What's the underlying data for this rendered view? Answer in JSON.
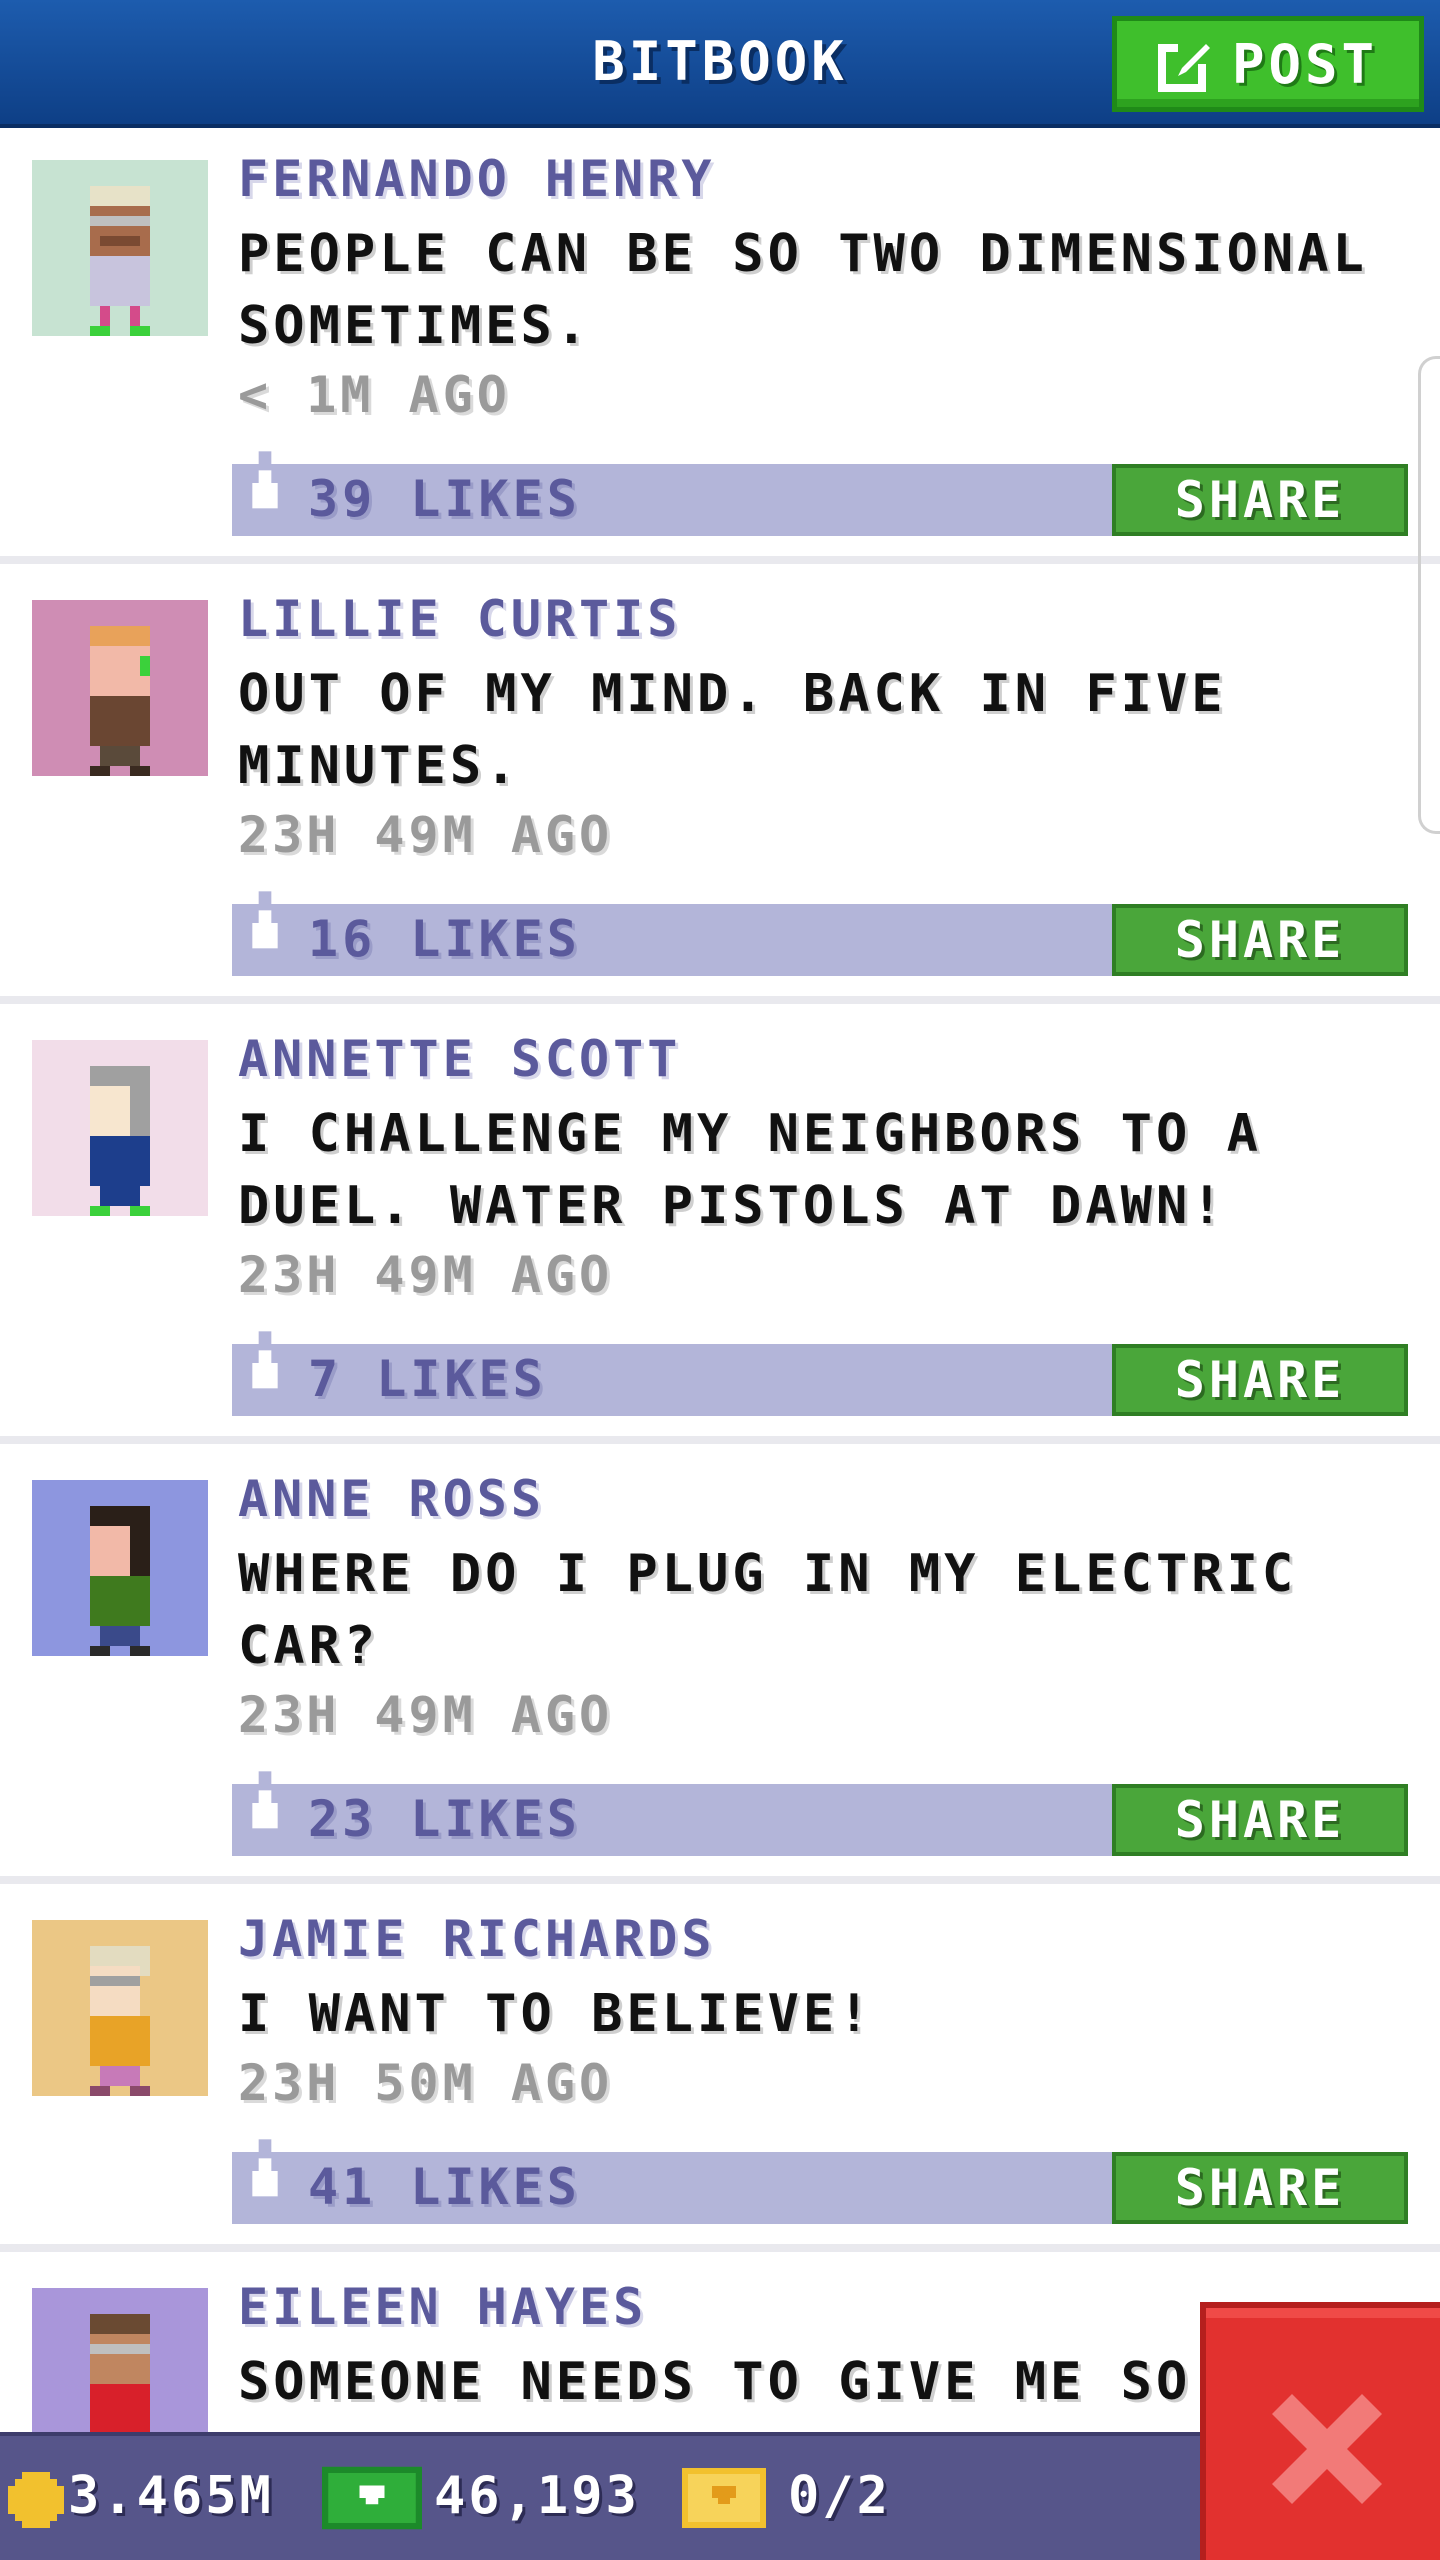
{
  "header": {
    "title": "BITBOOK",
    "post_label": "POST"
  },
  "posts": [
    {
      "name": "FERNANDO HENRY",
      "message": "PEOPLE CAN BE SO TWO DIMENSIONAL SOMETIMES.",
      "time": "< 1M AGO",
      "likes": "39 LIKES",
      "share": "SHARE",
      "avatar_bg": "#c7e3d2"
    },
    {
      "name": "LILLIE CURTIS",
      "message": "OUT OF MY MIND. BACK IN FIVE MINUTES.",
      "time": "23H 49M AGO",
      "likes": "16 LIKES",
      "share": "SHARE",
      "avatar_bg": "#cf8db4"
    },
    {
      "name": "ANNETTE SCOTT",
      "message": "I CHALLENGE MY NEIGHBORS TO A DUEL. WATER PISTOLS AT DAWN!",
      "time": "23H 49M AGO",
      "likes": "7 LIKES",
      "share": "SHARE",
      "avatar_bg": "#f2dde9"
    },
    {
      "name": "ANNE ROSS",
      "message": "WHERE DO I PLUG IN MY ELECTRIC CAR?",
      "time": "23H 49M AGO",
      "likes": "23 LIKES",
      "share": "SHARE",
      "avatar_bg": "#8d96df"
    },
    {
      "name": "JAMIE RICHARDS",
      "message": "I WANT TO BELIEVE!",
      "time": "23H 50M AGO",
      "likes": "41 LIKES",
      "share": "SHARE",
      "avatar_bg": "#ebc785"
    },
    {
      "name": "EILEEN HAYES",
      "message": "SOMEONE NEEDS TO GIVE ME SO",
      "avatar_bg": "#a996da"
    }
  ],
  "status": {
    "coins": "3.465M",
    "bux": "46,193",
    "tickets": "0/2"
  },
  "colors": {
    "header": "#1d5cae",
    "post_button": "#3fbf2c",
    "share_button": "#4aa63a",
    "like_bar": "#b3b5d9",
    "name_text": "#5b5a9c",
    "bottom_bar": "#56558a",
    "close_button": "#e2312f"
  },
  "icons": {
    "post": "edit-icon",
    "like": "thumb-up-icon",
    "coin": "coin-icon",
    "bux": "bux-icon",
    "ticket": "ticket-icon",
    "close": "close-icon"
  }
}
